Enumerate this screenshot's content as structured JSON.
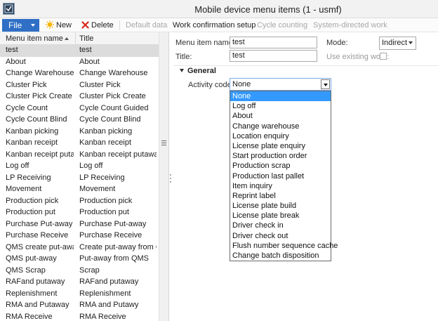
{
  "window": {
    "title": "Mobile device menu items (1 - usmf)"
  },
  "toolbar": {
    "file": "File",
    "new": "New",
    "delete": "Delete",
    "default_data": "Default data",
    "work_confirmation_setup": "Work confirmation setup",
    "cycle_counting": "Cycle counting",
    "system_directed_work": "System-directed work"
  },
  "list": {
    "col_name": "Menu item name",
    "col_title": "Title",
    "rows": [
      {
        "name": "test",
        "title": "test"
      },
      {
        "name": "About",
        "title": "About"
      },
      {
        "name": "Change Warehouse",
        "title": "Change Warehouse"
      },
      {
        "name": "Cluster Pick",
        "title": "Cluster Pick"
      },
      {
        "name": "Cluster Pick Create",
        "title": "Cluster Pick Create"
      },
      {
        "name": "Cycle Count",
        "title": "Cycle Count Guided"
      },
      {
        "name": "Cycle Count Blind",
        "title": "Cycle Count Blind"
      },
      {
        "name": "Kanban picking",
        "title": "Kanban picking"
      },
      {
        "name": "Kanban receipt",
        "title": "Kanban receipt"
      },
      {
        "name": "Kanban receipt puta...",
        "title": "Kanban receipt putaway"
      },
      {
        "name": "Log off",
        "title": "Log off"
      },
      {
        "name": "LP Receiving",
        "title": "LP Receiving"
      },
      {
        "name": "Movement",
        "title": "Movement"
      },
      {
        "name": "Production pick",
        "title": "Production pick"
      },
      {
        "name": "Production put",
        "title": "Production put"
      },
      {
        "name": "Purchase Put-away",
        "title": "Purchase Put-away"
      },
      {
        "name": "Purchase Receive",
        "title": "Purchase Receive"
      },
      {
        "name": "QMS create put-away",
        "title": "Create put-away from Q..."
      },
      {
        "name": "QMS put-away",
        "title": "Put-away from QMS"
      },
      {
        "name": "QMS Scrap",
        "title": "Scrap"
      },
      {
        "name": "RAFand putaway",
        "title": "RAFand putaway"
      },
      {
        "name": "Replenishment",
        "title": "Replenishment"
      },
      {
        "name": "RMA and Putaway",
        "title": "RMA and Putawy"
      },
      {
        "name": "RMA Receive",
        "title": "RMA Receive"
      }
    ]
  },
  "form": {
    "menu_item_name_label": "Menu item name:",
    "menu_item_name_value": "test",
    "title_label": "Title:",
    "title_value": "test",
    "mode_label": "Mode:",
    "mode_value": "Indirect",
    "use_existing_work_label": "Use existing work:",
    "use_existing_work_checked": false,
    "section_title": "General",
    "activity_code_label": "Activity code:",
    "activity_code_value": "None"
  },
  "dropdown": {
    "highlighted": "None",
    "options": [
      "None",
      "Log off",
      "About",
      "Change warehouse",
      "Location enquiry",
      "License plate enquiry",
      "Start production order",
      "Production scrap",
      "Production last pallet",
      "Item inquiry",
      "Reprint label",
      "License plate build",
      "License plate break",
      "Driver check in",
      "Driver check out",
      "Flush number sequence cache",
      "Change batch disposition"
    ]
  },
  "colors": {
    "file_button": "#2f6fc5",
    "highlight": "#3399ff",
    "selected_row": "#dcdcdc"
  },
  "icons": [
    "app-icon",
    "new-icon",
    "delete-icon",
    "sort-ascending-icon",
    "scrollbar-grip-icon",
    "collapse-triangle-icon",
    "dropdown-arrow-icon"
  ]
}
